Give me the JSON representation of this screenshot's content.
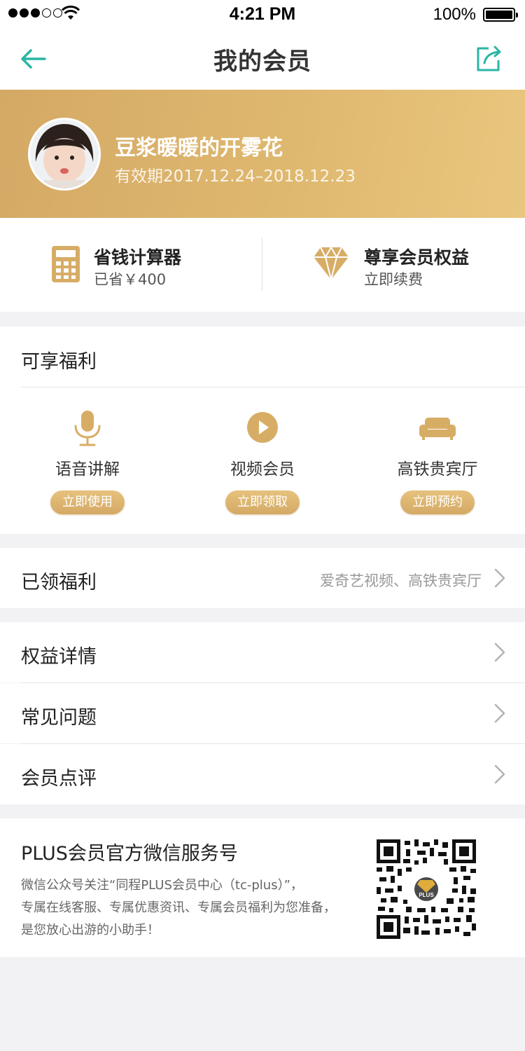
{
  "status_bar": {
    "time": "4:21 PM",
    "battery": "100%"
  },
  "nav": {
    "title": "我的会员",
    "back_icon": "arrow-left-icon",
    "share_icon": "share-icon",
    "accent_color": "#2bb5a4"
  },
  "member": {
    "name": "豆浆暖暖的开雾花",
    "validity": "有效期2017.12.24–2018.12.23",
    "gold_color": "#d9b06a"
  },
  "quick": [
    {
      "title": "省钱计算器",
      "subtitle": "已省￥400",
      "icon": "calculator-icon"
    },
    {
      "title": "尊享会员权益",
      "subtitle": "立即续费",
      "icon": "diamond-icon"
    }
  ],
  "benefits": {
    "title": "可享福利",
    "items": [
      {
        "label": "语音讲解",
        "action": "立即使用",
        "icon": "microphone-icon"
      },
      {
        "label": "视频会员",
        "action": "立即领取",
        "icon": "play-icon"
      },
      {
        "label": "高铁贵宾厅",
        "action": "立即预约",
        "icon": "sofa-icon"
      }
    ]
  },
  "claimed": {
    "label": "已领福利",
    "value": "爱奇艺视频、高铁贵宾厅"
  },
  "menu": [
    {
      "label": "权益详情"
    },
    {
      "label": "常见问题"
    },
    {
      "label": "会员点评"
    }
  ],
  "wechat": {
    "title": "PLUS会员官方微信服务号",
    "desc_lines": [
      "微信公众号关注“同程PLUS会员中心（tc-plus）”，",
      "专属在线客服、专属优惠资讯、专属会员福利为您准备，",
      "是您放心出游的小助手！"
    ],
    "qr_badge": "PLUS"
  }
}
